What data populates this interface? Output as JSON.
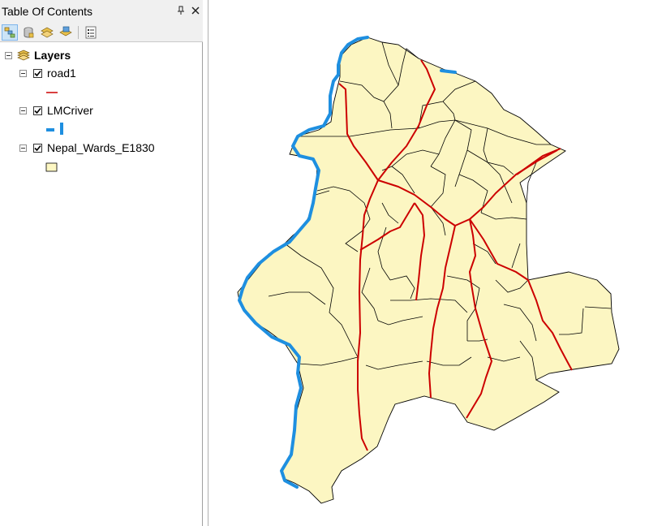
{
  "toc": {
    "title": "Table Of Contents",
    "pin_glyph": "⫧",
    "close_glyph": "✕"
  },
  "toolbar": {
    "buttons": [
      {
        "icon": "list-by-drawing-order-icon",
        "active": true
      },
      {
        "icon": "list-by-source-icon",
        "active": false
      },
      {
        "icon": "list-by-visibility-icon",
        "active": false
      },
      {
        "icon": "list-by-selection-icon",
        "active": false
      },
      {
        "icon": "options-icon",
        "active": false
      }
    ]
  },
  "layers": {
    "group_label": "Layers",
    "items": [
      {
        "name": "road1",
        "checked": true,
        "symbol": "red-line",
        "color": "#cc0000"
      },
      {
        "name": "LMCriver",
        "checked": true,
        "symbol": "blue-line",
        "color": "#1e8fe0"
      },
      {
        "name": "Nepal_Wards_E1830",
        "checked": true,
        "symbol": "polygon-fill",
        "color": "#fdf7c3"
      }
    ]
  },
  "map": {
    "polygon_fill": "#fcf6c2",
    "outline_color": "#000000",
    "road_color": "#cc0000",
    "river_color": "#1e8fe0"
  }
}
